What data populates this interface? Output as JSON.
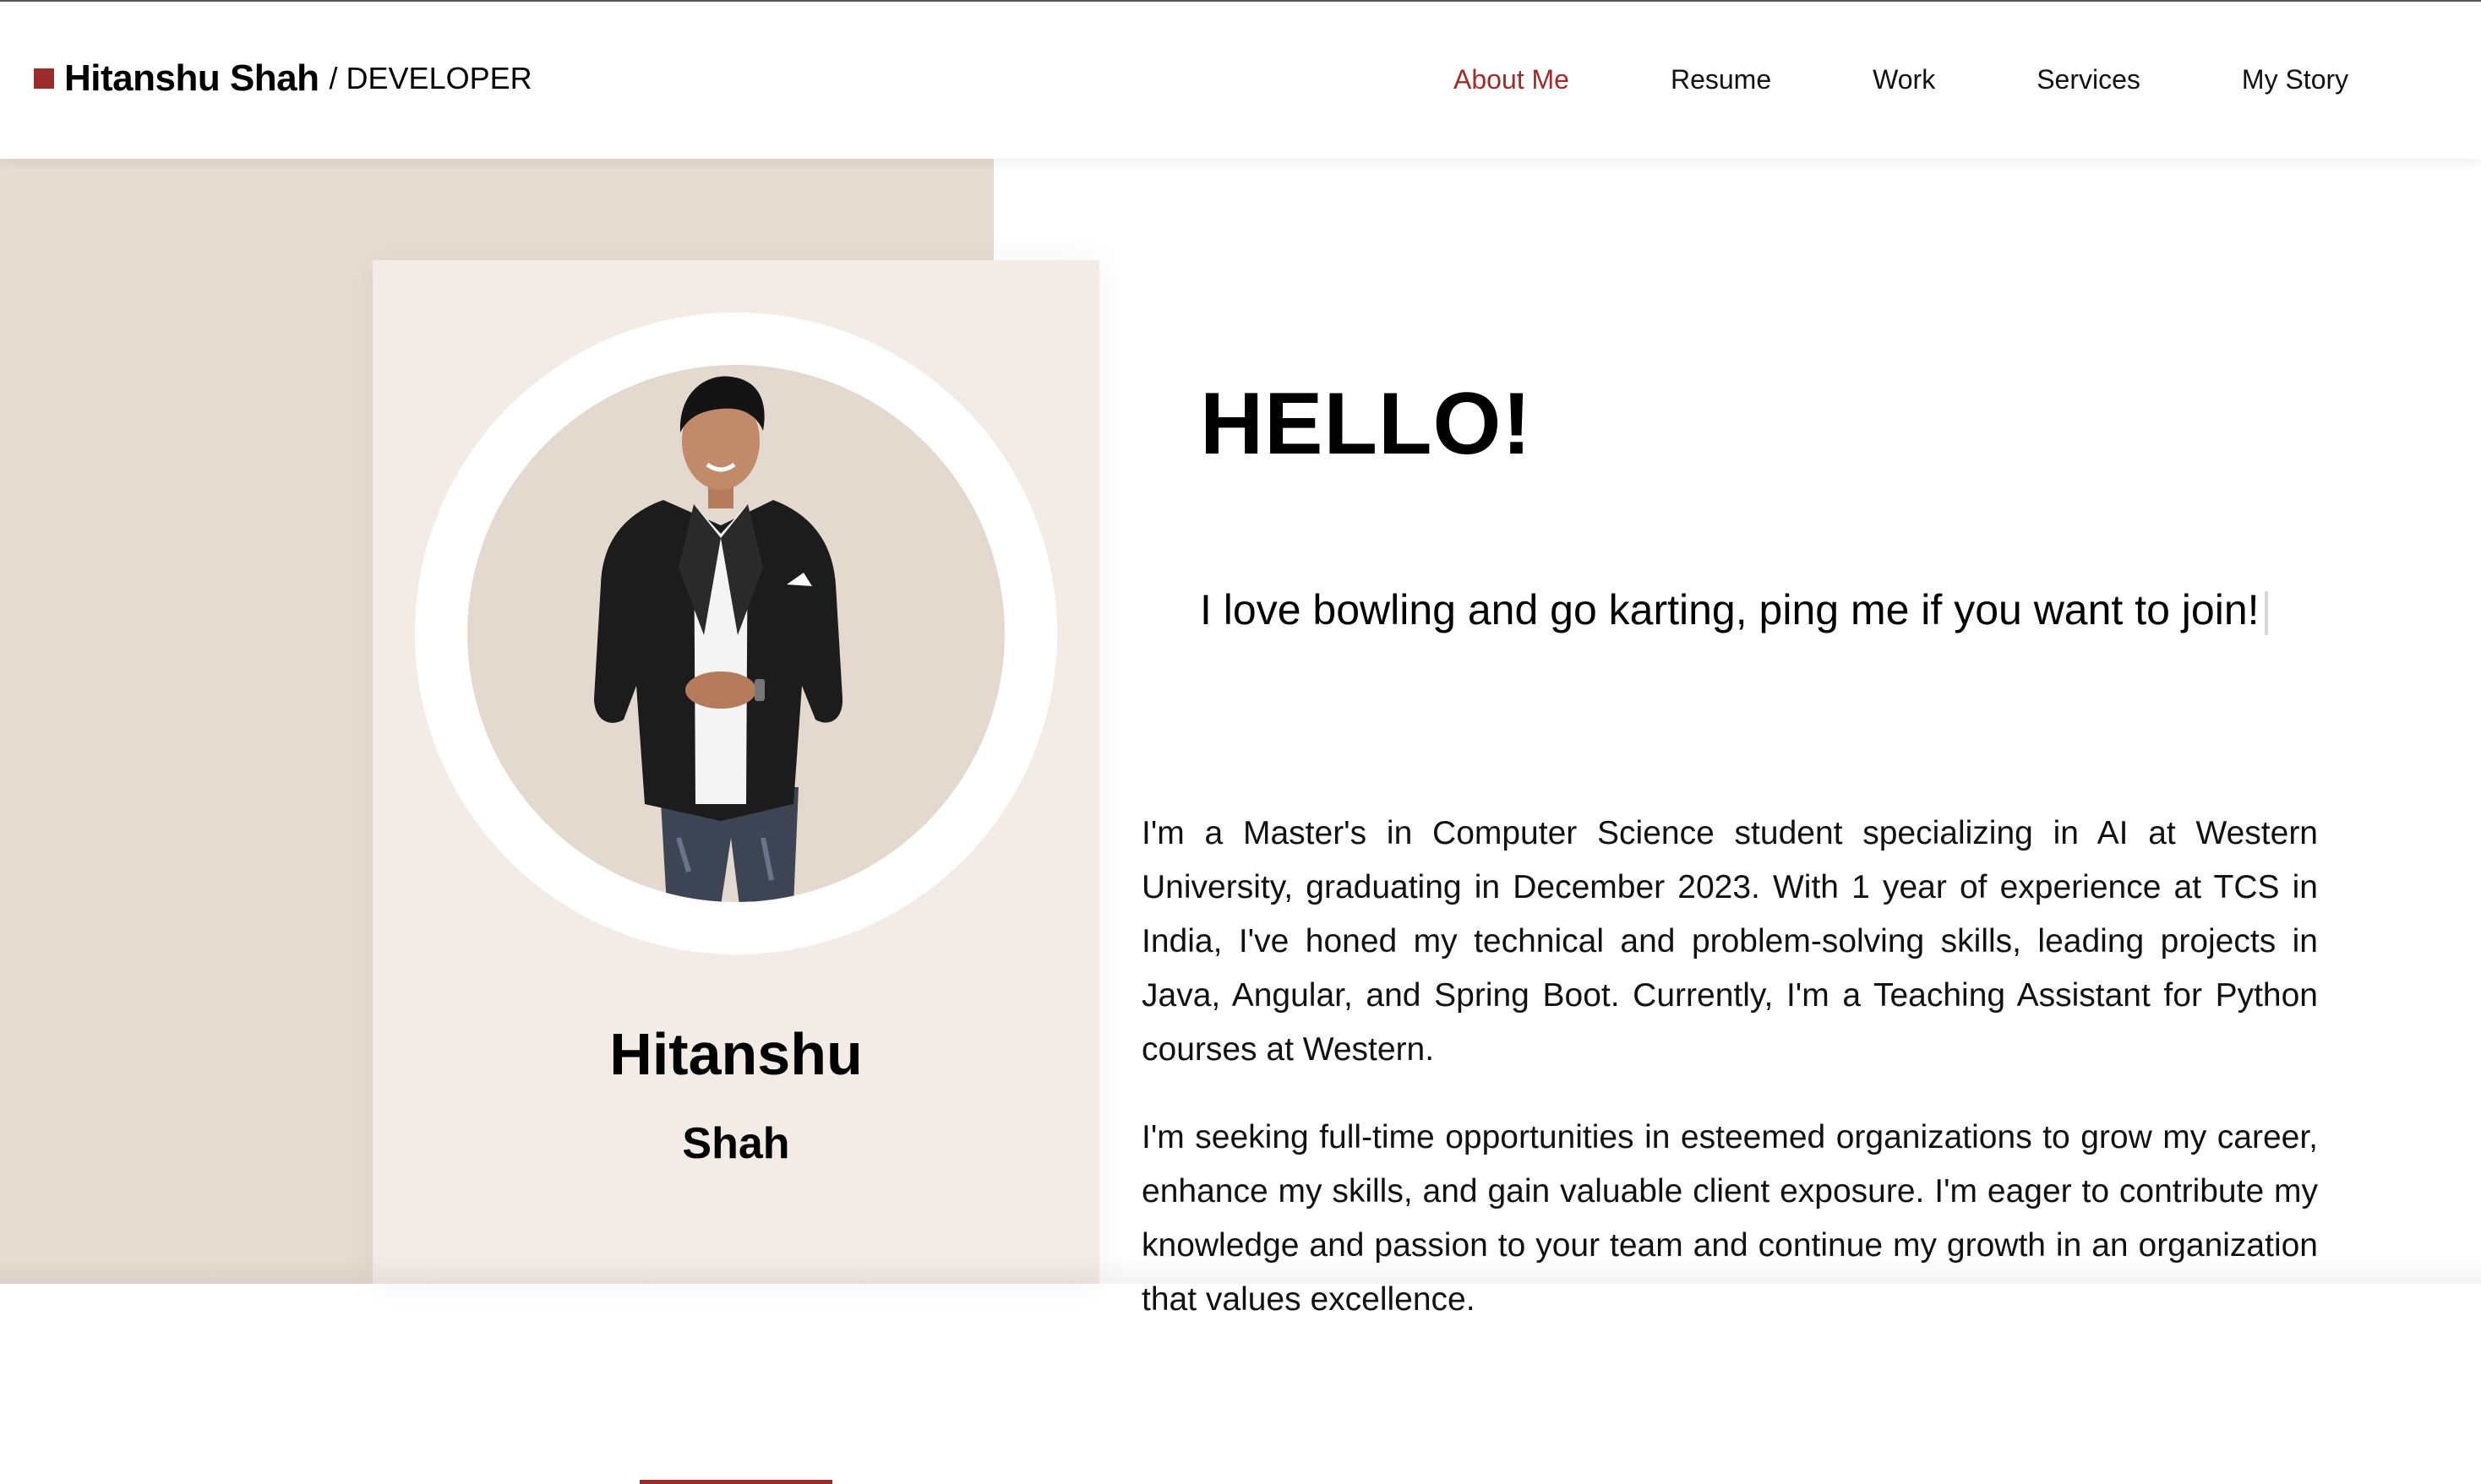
{
  "header": {
    "brand_name": "Hitanshu Shah",
    "brand_role": "/ DEVELOPER",
    "nav": [
      {
        "label": "About Me",
        "active": true
      },
      {
        "label": "Resume",
        "active": false
      },
      {
        "label": "Work",
        "active": false
      },
      {
        "label": "Services",
        "active": false
      },
      {
        "label": "My Story",
        "active": false
      }
    ]
  },
  "profile": {
    "first_name": "Hitanshu",
    "last_name": "Shah",
    "photo_icon": "person-photo-icon"
  },
  "main": {
    "heading": "HELLO!",
    "tagline": "I love bowling and go karting, ping me if you want to join!",
    "paragraphs": [
      "I'm a Master's in Computer Science student specializing in AI at Western University, graduating in December 2023. With 1 year of experience at TCS in India, I've honed my technical and problem-solving skills, leading projects in Java, Angular, and Spring Boot. Currently, I'm a Teaching Assistant for Python courses at Western.",
      "I'm seeking full-time opportunities in esteemed organizations to grow my career, enhance my skills, and gain valuable client exposure. I'm eager to contribute my knowledge and passion to your team and continue my growth in an organization that values excellence."
    ]
  },
  "colors": {
    "accent": "#9b2d2a",
    "left_panel": "#e6dcd2",
    "card": "#f2ebe6"
  }
}
